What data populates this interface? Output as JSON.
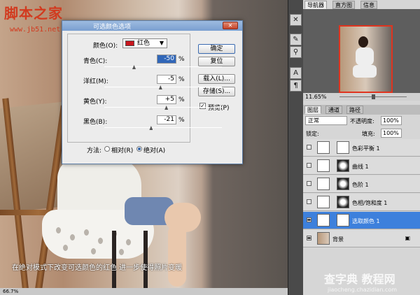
{
  "site": {
    "watermark": "脚本之家",
    "url": "www.jb51.net",
    "bottom_watermark": "查字典 教程网",
    "bottom_url": "jiaocheng.chazidian.com"
  },
  "caption": "在绝对模式下改变可选颜色的红色 进一步使得照片变暖",
  "status": "66.7%",
  "dialog": {
    "title": "可选颜色选项",
    "close_glyph": "✕",
    "color_label": "颜色(O):",
    "color_value": "红色",
    "color_swatch_hex": "#c8171e",
    "sliders": [
      {
        "label": "青色(C):",
        "value": "-50",
        "unit": "%",
        "level_pct": -50
      },
      {
        "label": "洋红(M):",
        "value": "-5",
        "unit": "%",
        "level_pct": -5
      },
      {
        "label": "黄色(Y):",
        "value": "+5",
        "unit": "%",
        "level_pct": 5
      },
      {
        "label": "黑色(B):",
        "value": "-21",
        "unit": "%",
        "level_pct": -21
      }
    ],
    "buttons": {
      "ok": "确定",
      "reset": "复位",
      "load": "载入(L)...",
      "save": "存储(S)..."
    },
    "preview_label": "预览(P)",
    "preview_checked": true,
    "method_label": "方法:",
    "method_relative": "相对(R)",
    "method_absolute": "绝对(A)",
    "method_selected": "absolute"
  },
  "navigator": {
    "tabs": [
      "导航器",
      "直方图",
      "信息"
    ],
    "zoom": "11.65%"
  },
  "layers": {
    "tabs": [
      "图层",
      "通道",
      "路径"
    ],
    "blend_mode": "正常",
    "opacity_label": "不透明度:",
    "opacity_value": "100%",
    "lock_label": "锁定:",
    "fill_label": "填充:",
    "fill_value": "100%",
    "items": [
      {
        "name": "色彩平衡 1",
        "visible": false,
        "selected": false
      },
      {
        "name": "曲线 1",
        "visible": false,
        "selected": false
      },
      {
        "name": "色阶 1",
        "visible": false,
        "selected": false
      },
      {
        "name": "色相/饱和度 1",
        "visible": false,
        "selected": false
      },
      {
        "name": "选取颜色 1",
        "visible": true,
        "selected": true
      },
      {
        "name": "背景",
        "visible": true,
        "selected": false
      }
    ]
  },
  "colors": {
    "selection": "#3d80dc",
    "accent_red": "#e0341f"
  }
}
